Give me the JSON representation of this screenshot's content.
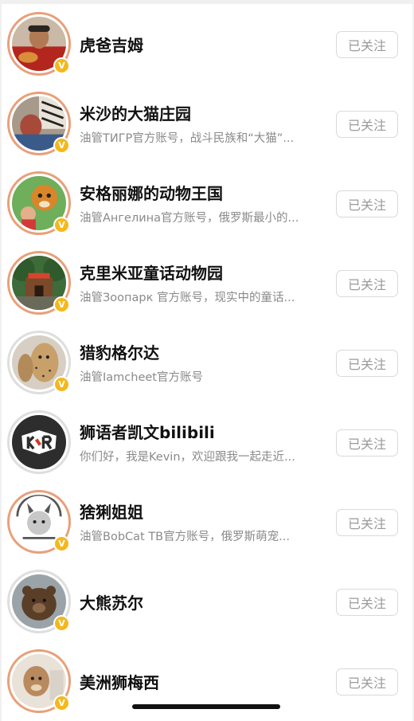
{
  "follow_button_label": "已关注",
  "verified_badge": "V",
  "accounts": [
    {
      "name": "虎爸吉姆",
      "desc": ""
    },
    {
      "name": "米沙的大猫庄园",
      "desc": "油管ТИГР官方账号，战斗民族和“大猫”..."
    },
    {
      "name": "安格丽娜的动物王国",
      "desc": "油管Ангелина官方账号，俄罗斯最小的..."
    },
    {
      "name": "克里米亚童话动物园",
      "desc": "油管Зоопарк 官方账号，现实中的童话..."
    },
    {
      "name": "猎豹格尔达",
      "desc": "油管Iamcheet官方账号"
    },
    {
      "name": "狮语者凯文bilibili",
      "desc": "你们好，我是Kevin，欢迎跟我一起走近..."
    },
    {
      "name": "猞猁姐姐",
      "desc": "油管BobCat TB官方账号，俄罗斯萌宠..."
    },
    {
      "name": "大熊苏尔",
      "desc": ""
    },
    {
      "name": "美洲狮梅西",
      "desc": ""
    }
  ],
  "colors": {
    "avatar_ring": "#e8a07a",
    "verified_badge": "#f5b81c",
    "button_border": "#d9d9d9",
    "button_text": "#9a9a9a"
  }
}
